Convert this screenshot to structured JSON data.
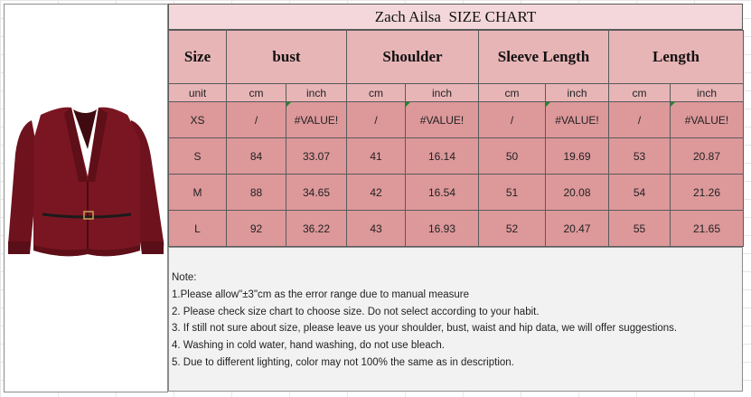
{
  "title": "Zach Ailsa  SIZE CHART",
  "headers": [
    "Size",
    "bust",
    "Shoulder",
    "Sleeve Length",
    "Length"
  ],
  "units": [
    "unit",
    "cm",
    "inch",
    "cm",
    "inch",
    "cm",
    "inch",
    "cm",
    "inch"
  ],
  "rows": [
    [
      "XS",
      "/",
      "#VALUE!",
      "/",
      "#VALUE!",
      "/",
      "#VALUE!",
      "/",
      "#VALUE!"
    ],
    [
      "S",
      "84",
      "33.07",
      "41",
      "16.14",
      "50",
      "19.69",
      "53",
      "20.87"
    ],
    [
      "M",
      "88",
      "34.65",
      "42",
      "16.54",
      "51",
      "20.08",
      "54",
      "21.26"
    ],
    [
      "L",
      "92",
      "36.22",
      "43",
      "16.93",
      "52",
      "20.47",
      "55",
      "21.65"
    ]
  ],
  "notes": {
    "heading": "Note:",
    "items": [
      "1.Please allow\"±3\"cm as the error range due to manual measure",
      "2. Please check size chart to choose size. Do not select according to your habit.",
      "3. If still not sure about size, please leave us your shoulder, bust, waist and hip data, we will offer suggestions.",
      "4. Washing in cold water, hand washing, do not use bleach.",
      "5. Due to different lighting, color may not 100% the same as in description."
    ]
  },
  "colors": {
    "header_bg": "#e8b5b7",
    "data_bg": "#dd989a",
    "title_bg": "#f3d7da",
    "notes_bg": "#f2f2f2",
    "garment": "#7a1622"
  }
}
